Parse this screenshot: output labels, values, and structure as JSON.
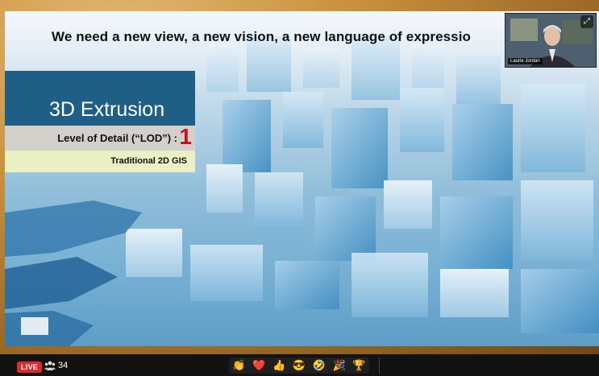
{
  "slide": {
    "title": "We need a new view, a new vision, a new language of expressio",
    "lod_heading": "3D Extrusion",
    "lod_label": "Level of Detail (“LOD”) :",
    "lod_value": "1",
    "lod_sub": "Traditional 2D GIS"
  },
  "webcam": {
    "name": "Laurie Jordan",
    "expand_icon": "expand-icon"
  },
  "bottom_bar": {
    "live_label": "LIVE",
    "viewer_icon": "viewers-icon",
    "viewer_count": "34",
    "reactions": [
      {
        "name": "clap-reaction-icon",
        "glyph": "👏"
      },
      {
        "name": "heart-reaction-icon",
        "glyph": "❤️"
      },
      {
        "name": "thumbs-up-reaction-icon",
        "glyph": "👍"
      },
      {
        "name": "cool-reaction-icon",
        "glyph": "😎"
      },
      {
        "name": "laugh-reaction-icon",
        "glyph": "🤣"
      },
      {
        "name": "party-reaction-icon",
        "glyph": "🎉"
      },
      {
        "name": "trophy-reaction-icon",
        "glyph": "🏆"
      }
    ]
  },
  "colors": {
    "lod_heading_bg": "#1f5f86",
    "lod_value": "#c4131a",
    "lod_sub_bg": "#e9f1c4",
    "live_badge": "#e0292d"
  }
}
